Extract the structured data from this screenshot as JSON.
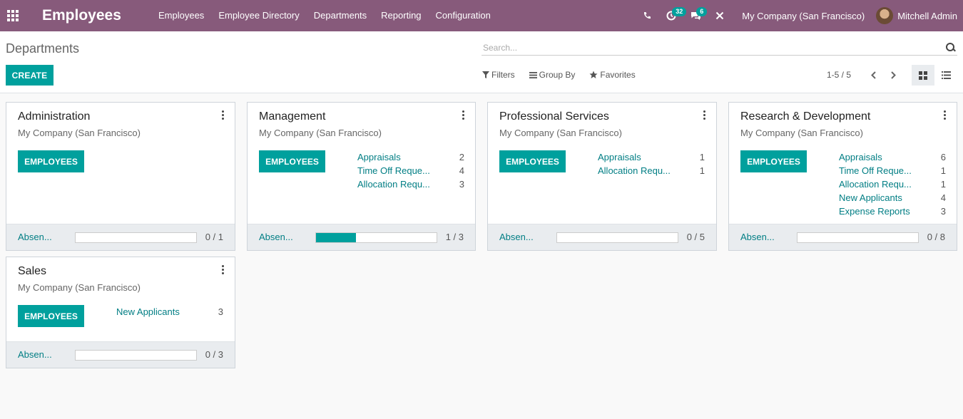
{
  "navbar": {
    "app_title": "Employees",
    "menu": [
      "Employees",
      "Employee Directory",
      "Departments",
      "Reporting",
      "Configuration"
    ],
    "activity_count": "32",
    "message_count": "6",
    "company": "My Company (San Francisco)",
    "user": "Mitchell Admin",
    "icons": [
      "apps-grid-icon",
      "phone-icon",
      "clock-icon",
      "chat-icon",
      "debug-tools-icon"
    ]
  },
  "control_panel": {
    "breadcrumb": "Departments",
    "create_label": "CREATE",
    "search_placeholder": "Search...",
    "filters_label": "Filters",
    "groupby_label": "Group By",
    "favorites_label": "Favorites",
    "pager": "1-5 / 5"
  },
  "departments": [
    {
      "name": "Administration",
      "company": "My Company (San Francisco)",
      "button": "EMPLOYEES",
      "stats": [],
      "absence_label": "Absen...",
      "absence_ratio": "0 / 1",
      "absence_fraction": 0
    },
    {
      "name": "Management",
      "company": "My Company (San Francisco)",
      "button": "EMPLOYEES",
      "stats": [
        {
          "label": "Appraisals",
          "count": "2"
        },
        {
          "label": "Time Off Reque...",
          "count": "4"
        },
        {
          "label": "Allocation Requ...",
          "count": "3"
        }
      ],
      "absence_label": "Absen...",
      "absence_ratio": "1 / 3",
      "absence_fraction": 0.333
    },
    {
      "name": "Professional Services",
      "company": "My Company (San Francisco)",
      "button": "EMPLOYEES",
      "stats": [
        {
          "label": "Appraisals",
          "count": "1"
        },
        {
          "label": "Allocation Requ...",
          "count": "1"
        }
      ],
      "absence_label": "Absen...",
      "absence_ratio": "0 / 5",
      "absence_fraction": 0
    },
    {
      "name": "Research & Development",
      "company": "My Company (San Francisco)",
      "button": "EMPLOYEES",
      "stats": [
        {
          "label": "Appraisals",
          "count": "6"
        },
        {
          "label": "Time Off Reque...",
          "count": "1"
        },
        {
          "label": "Allocation Requ...",
          "count": "1"
        },
        {
          "label": "New Applicants",
          "count": "4"
        },
        {
          "label": "Expense Reports",
          "count": "3"
        }
      ],
      "absence_label": "Absen...",
      "absence_ratio": "0 / 8",
      "absence_fraction": 0
    },
    {
      "name": "Sales",
      "company": "My Company (San Francisco)",
      "button": "EMPLOYEES",
      "stats": [
        {
          "label": "New Applicants",
          "count": "3"
        }
      ],
      "absence_label": "Absen...",
      "absence_ratio": "0 / 3",
      "absence_fraction": 0
    }
  ],
  "colors": {
    "navbar": "#875a7b",
    "primary": "#00a09d",
    "link": "#017e84"
  }
}
